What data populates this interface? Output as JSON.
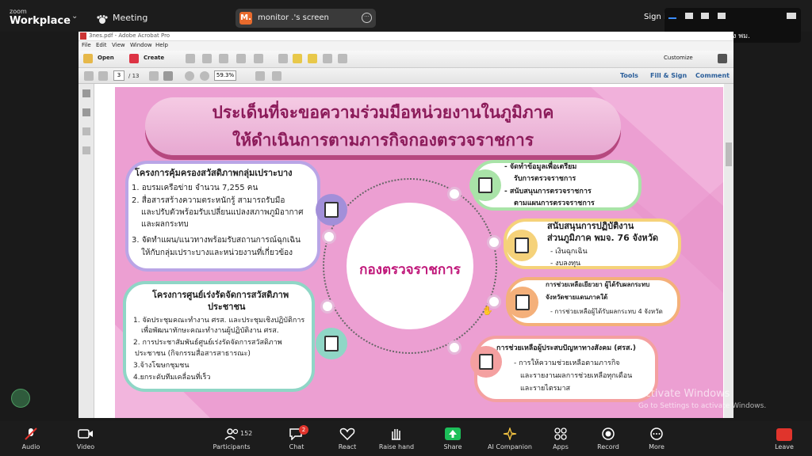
{
  "zoom": {
    "brand_small": "zoom",
    "brand_big": "Workplace",
    "meeting_label": "Meeting",
    "screen_badge": "M.",
    "screen_label": "monitor .'s screen",
    "sign_in": "Sign i",
    "talking": "Talking: กระทรวง พม."
  },
  "acrobat": {
    "title": "3nes.pdf - Adobe Acrobat Pro",
    "menus": [
      "File",
      "Edit",
      "View",
      "Window",
      "Help"
    ],
    "open_label": "Open",
    "create_label": "Create",
    "customize_label": "Customize",
    "page_current": "3",
    "page_total": "/ 13",
    "zoom_value": "59.3%",
    "tools_label": "Tools",
    "fill_sign_label": "Fill & Sign",
    "comment_label": "Comment"
  },
  "slide": {
    "title_line1": "ประเด็นที่จะขอความร่วมมือหน่วยงานในภูมิภาค",
    "title_line2": "ให้ดำเนินการตามภารกิจกองตรวจราชการ",
    "center_label": "กองตรวจราชการ",
    "left_top": {
      "heading": "โครงการคุ้มครองสวัสดิภาพกลุ่มเปราะบาง",
      "lines": [
        "1. อบรมเครือข่าย จำนวน 7,255 คน",
        "2. สื่อสารสร้างความตระหนักรู้ สามารถรับมือ",
        "และปรับตัวพร้อมรับเปลี่ยนแปลงสภาพภูมิอากาศ",
        "และผลกระทบ",
        "3. จัดทำแผน/แนวทางพร้อมรับสถานการณ์ฉุกเฉิน",
        "ให้กับกลุ่มเปราะบางและหน่วยงานที่เกี่ยวข้อง"
      ]
    },
    "left_bottom": {
      "heading": "โครงการศูนย์เร่งรัดจัดการสวัสดิภาพ",
      "heading2": "ประชาชน",
      "lines": [
        "1. จัดประชุมคณะทำงาน ศรส. และประชุมเชิงปฏิบัติการ",
        "เพื่อพัฒนาทักษะคณะทำงานผู้ปฏิบัติงาน ศรส.",
        "2. การประชาสัมพันธ์ศูนย์เร่งรัดจัดการสวัสดิภาพ",
        "ประชาชน (กิจกรรมสื่อสารสาธารณะ)",
        "3.จ้างโฆษกชุมชน",
        "4.ยกระดับทีมเคลื่อนที่เร็ว"
      ]
    },
    "right1": {
      "lines": [
        "- จัดทำข้อมูลเพื่อเตรียม",
        "รับการตรวจราชการ",
        "- สนับสนุนการตรวจราชการ",
        "ตามแผนการตรวจราชการ"
      ]
    },
    "right2": {
      "heading": "สนับสนุนการปฏิบัติงาน",
      "heading2": "ส่วนภูมิภาค พมจ. 76 จังหวัด",
      "lines": [
        "- เงินฉุกเฉิน",
        "- งบลงทุน"
      ]
    },
    "right3": {
      "heading": "การช่วยเหลือเยียวยา ผู้ได้รับผลกระทบ",
      "heading2": "จังหวัดชายแดนภาคใต้",
      "lines": [
        "- การช่วยเหลือผู้ได้รับผลกระทบ 4 จังหวัด"
      ]
    },
    "right4": {
      "heading": "การช่วยเหลือผู้ประสบปัญหาทางสังคม (ศรส.)",
      "lines": [
        "- การให้ความช่วยเหลือตามภารกิจ",
        "และรายงานผลการช่วยเหลือทุกเดือน",
        "และรายไตรมาส"
      ]
    }
  },
  "watermark": {
    "line1": "Activate Windows",
    "line2": "Go to Settings to activate Windows."
  },
  "bottombar": {
    "audio": "Audio",
    "video": "Video",
    "participants": "Participants",
    "participants_count": "152",
    "chat": "Chat",
    "chat_badge": "2",
    "react": "React",
    "raise_hand": "Raise hand",
    "share": "Share",
    "ai_companion": "AI Companion",
    "apps": "Apps",
    "record": "Record",
    "more": "More",
    "leave": "Leave"
  },
  "colors": {
    "slide_bg": "#ec9fd2",
    "title_text": "#8c1b5a",
    "center_text": "#c0187a",
    "share_green": "#1dbf5a",
    "leave_red": "#e0342c"
  }
}
